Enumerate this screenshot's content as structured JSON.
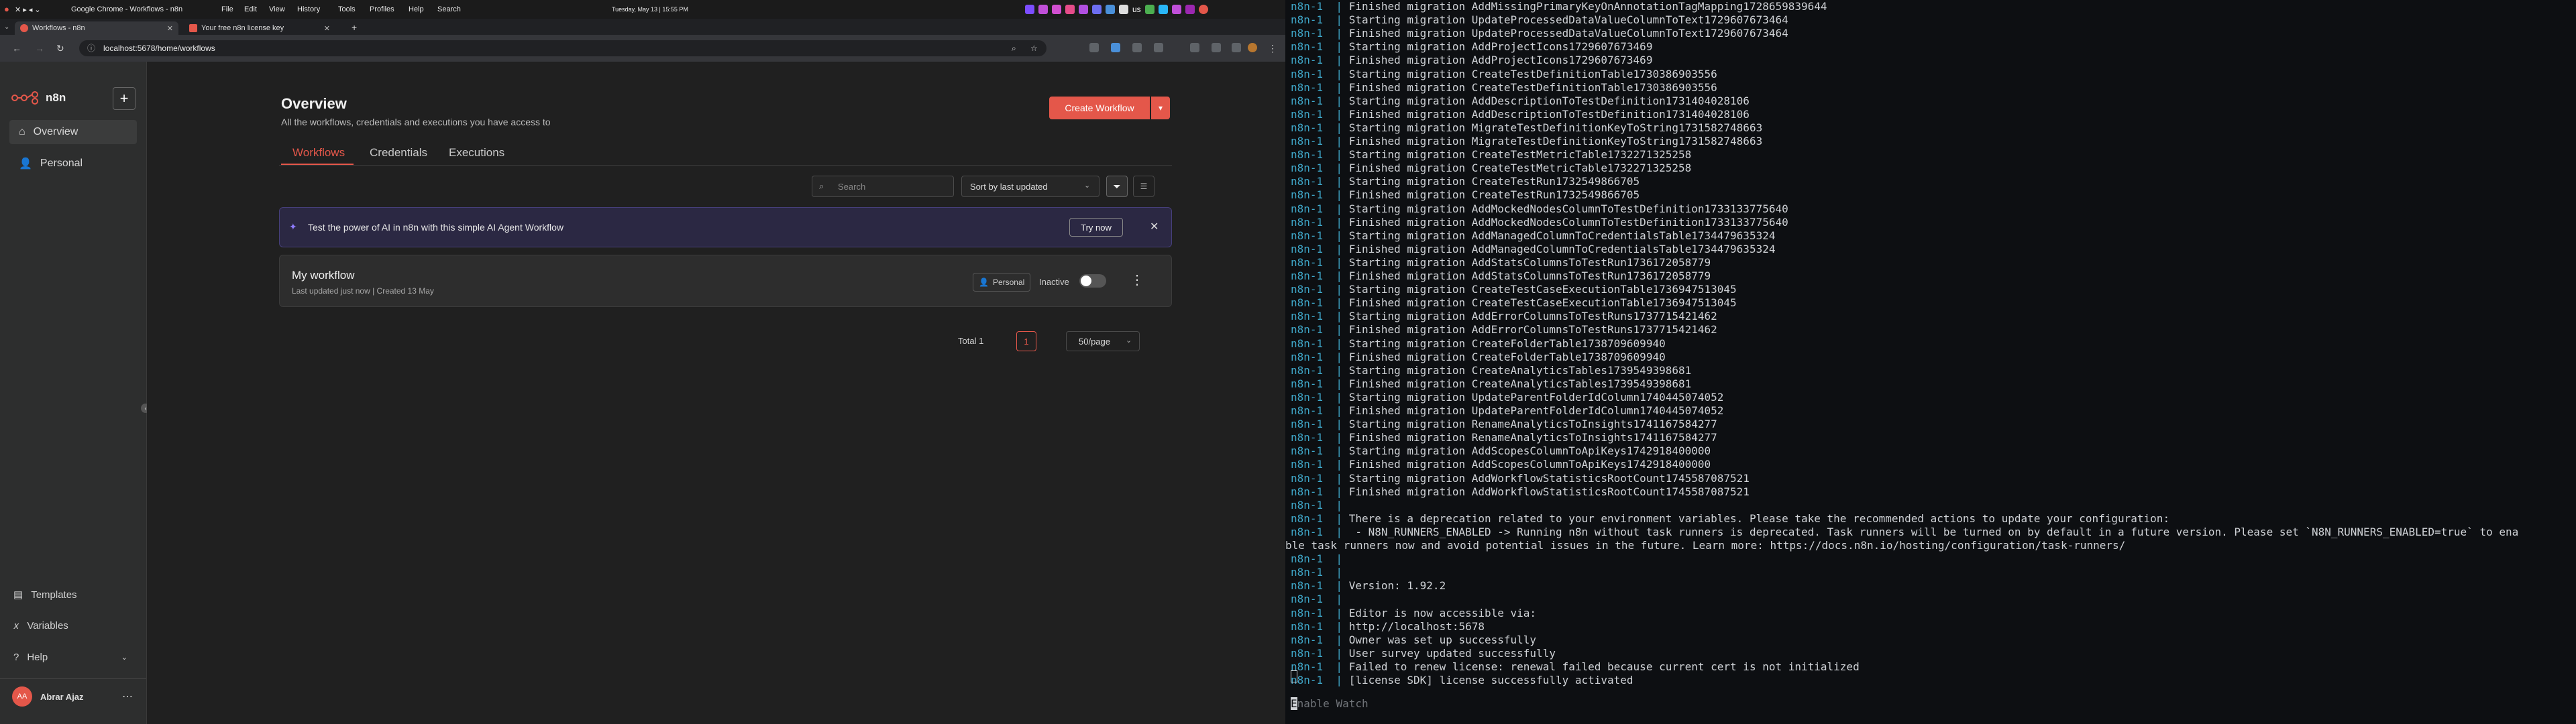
{
  "system_bar": {
    "menus": [
      "Google Chrome - Workflows - n8n",
      "File",
      "Edit",
      "View",
      "History",
      "Tools",
      "Profiles",
      "Help",
      "Search"
    ],
    "clock": "Tuesday, May 13 | 15:55 PM",
    "tray_text": "us"
  },
  "browser": {
    "tabs": [
      {
        "label": "Workflows - n8n"
      },
      {
        "label": "Your free n8n license key"
      }
    ],
    "url": "localhost:5678/home/workflows"
  },
  "sidebar": {
    "logo_text": "n8n",
    "items": [
      {
        "label": "Overview",
        "icon": "home-icon"
      },
      {
        "label": "Personal",
        "icon": "user-icon"
      }
    ],
    "bottom_items": [
      {
        "label": "Templates",
        "icon": "templates-icon"
      },
      {
        "label": "Variables",
        "icon": "variables-icon"
      },
      {
        "label": "Help",
        "icon": "help-icon"
      }
    ],
    "user": {
      "initials": "AA",
      "name": "Abrar Ajaz"
    }
  },
  "overview": {
    "title": "Overview",
    "subtitle": "All the workflows, credentials and executions you have access to",
    "create_button": "Create Workflow",
    "tabs": [
      {
        "label": "Workflows",
        "active": true
      },
      {
        "label": "Credentials",
        "active": false
      },
      {
        "label": "Executions",
        "active": false
      }
    ],
    "search_placeholder": "Search",
    "sort_label": "Sort by last updated"
  },
  "banner": {
    "text": "Test the power of AI in n8n with this simple AI Agent Workflow",
    "button": "Try now"
  },
  "workflow": {
    "name": "My workflow",
    "meta": "Last updated just now | Created 13 May",
    "owner": "Personal",
    "status": "Inactive"
  },
  "pagination": {
    "total": "Total 1",
    "page": "1",
    "per_page": "50/page"
  },
  "terminal": {
    "prefix": "n8n-1",
    "lines": [
      "Finished migration AddMissingPrimaryKeyOnAnnotationTagMapping1728659839644",
      "Starting migration UpdateProcessedDataValueColumnToText1729607673464",
      "Finished migration UpdateProcessedDataValueColumnToText1729607673464",
      "Starting migration AddProjectIcons1729607673469",
      "Finished migration AddProjectIcons1729607673469",
      "Starting migration CreateTestDefinitionTable1730386903556",
      "Finished migration CreateTestDefinitionTable1730386903556",
      "Starting migration AddDescriptionToTestDefinition1731404028106",
      "Finished migration AddDescriptionToTestDefinition1731404028106",
      "Starting migration MigrateTestDefinitionKeyToString1731582748663",
      "Finished migration MigrateTestDefinitionKeyToString1731582748663",
      "Starting migration CreateTestMetricTable1732271325258",
      "Finished migration CreateTestMetricTable1732271325258",
      "Starting migration CreateTestRun1732549866705",
      "Finished migration CreateTestRun1732549866705",
      "Starting migration AddMockedNodesColumnToTestDefinition1733133775640",
      "Finished migration AddMockedNodesColumnToTestDefinition1733133775640",
      "Starting migration AddManagedColumnToCredentialsTable1734479635324",
      "Finished migration AddManagedColumnToCredentialsTable1734479635324",
      "Starting migration AddStatsColumnsToTestRun1736172058779",
      "Finished migration AddStatsColumnsToTestRun1736172058779",
      "Starting migration CreateTestCaseExecutionTable1736947513045",
      "Finished migration CreateTestCaseExecutionTable1736947513045",
      "Starting migration AddErrorColumnsToTestRuns1737715421462",
      "Finished migration AddErrorColumnsToTestRuns1737715421462",
      "Starting migration CreateFolderTable1738709609940",
      "Finished migration CreateFolderTable1738709609940",
      "Starting migration CreateAnalyticsTables1739549398681",
      "Finished migration CreateAnalyticsTables1739549398681",
      "Starting migration UpdateParentFolderIdColumn1740445074052",
      "Finished migration UpdateParentFolderIdColumn1740445074052",
      "Starting migration RenameAnalyticsToInsights1741167584277",
      "Finished migration RenameAnalyticsToInsights1741167584277",
      "Starting migration AddScopesColumnToApiKeys1742918400000",
      "Finished migration AddScopesColumnToApiKeys1742918400000",
      "Starting migration AddWorkflowStatisticsRootCount1745587087521",
      "Finished migration AddWorkflowStatisticsRootCount1745587087521",
      "",
      "There is a deprecation related to your environment variables. Please take the recommended actions to update your configuration:",
      " - N8N_RUNNERS_ENABLED -> Running n8n without task runners is deprecated. Task runners will be turned on by default in a future version. Please set `N8N_RUNNERS_ENABLED=true` to ena"
    ],
    "wrap_line": "ble task runners now and avoid potential issues in the future. Learn more: https://docs.n8n.io/hosting/configuration/task-runners/",
    "tail_lines": [
      "",
      "",
      "Version: 1.92.2",
      "",
      "Editor is now accessible via:",
      "http://localhost:5678",
      "Owner was set up successfully",
      "User survey updated successfully",
      "Failed to renew license: renewal failed because current cert is not initialized",
      "[license SDK] license successfully activated"
    ],
    "footer": "Enable Watch"
  }
}
